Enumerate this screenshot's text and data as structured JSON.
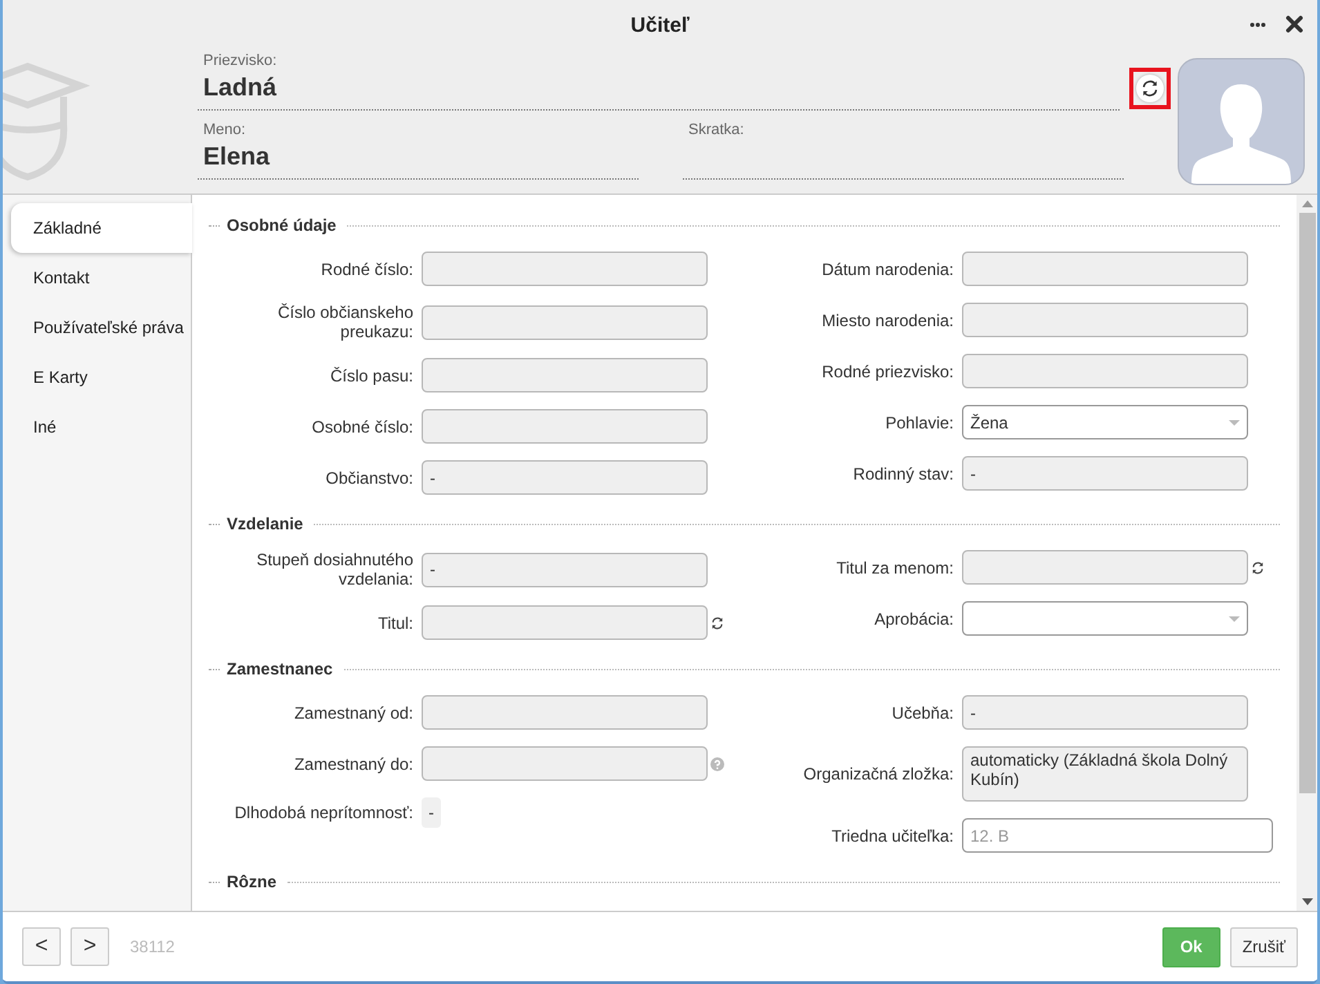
{
  "window": {
    "title": "Učiteľ"
  },
  "header": {
    "surname": {
      "label": "Priezvisko:",
      "value": "Ladná"
    },
    "first_name": {
      "label": "Meno:",
      "value": "Elena"
    },
    "abbreviation": {
      "label": "Skratka:"
    },
    "refresh_highlighted": true
  },
  "tabs": [
    {
      "label": "Základné",
      "selected": true
    },
    {
      "label": "Kontakt",
      "selected": false
    },
    {
      "label": "Používateľské práva",
      "selected": false
    },
    {
      "label": "E Karty",
      "selected": false
    },
    {
      "label": "Iné",
      "selected": false
    }
  ],
  "sections": [
    {
      "title": "Osobné údaje",
      "columns": [
        [
          {
            "kind": "text",
            "label": "Rodné číslo:",
            "editable": false
          },
          {
            "kind": "text",
            "label": "Číslo občianskeho preukazu:",
            "editable": false
          },
          {
            "kind": "text",
            "label": "Číslo pasu:",
            "editable": false
          },
          {
            "kind": "text",
            "label": "Osobné číslo:",
            "editable": false
          },
          {
            "kind": "text",
            "label": "Občianstvo:",
            "value": "-",
            "editable": false
          }
        ],
        [
          {
            "kind": "text",
            "label": "Dátum narodenia:",
            "editable": false
          },
          {
            "kind": "text",
            "label": "Miesto narodenia:",
            "editable": false
          },
          {
            "kind": "text",
            "label": "Rodné priezvisko:",
            "editable": false
          },
          {
            "kind": "select",
            "label": "Pohlavie:",
            "value": "Žena",
            "editable": true
          },
          {
            "kind": "text",
            "label": "Rodinný stav:",
            "value": "-",
            "editable": false
          }
        ]
      ]
    },
    {
      "title": "Vzdelanie",
      "columns": [
        [
          {
            "kind": "text",
            "label": "Stupeň dosiahnutého vzdelania:",
            "value": "-",
            "editable": false
          },
          {
            "kind": "text",
            "label": "Titul:",
            "editable": false,
            "refresh_button": true
          }
        ],
        [
          {
            "kind": "text",
            "label": "Titul za menom:",
            "editable": false,
            "refresh_button": true
          },
          {
            "kind": "select",
            "label": "Aprobácia:",
            "editable": true
          }
        ]
      ]
    },
    {
      "title": "Zamestnanec",
      "columns": [
        [
          {
            "kind": "text",
            "label": "Zamestnaný od:",
            "editable": false
          },
          {
            "kind": "text",
            "label": "Zamestnaný do:",
            "editable": false,
            "help_icon": true
          },
          {
            "kind": "static",
            "label": "Dlhodobá neprítomnosť:",
            "value": "-"
          }
        ],
        [
          {
            "kind": "text",
            "label": "Učebňa:",
            "value": "-",
            "editable": false
          },
          {
            "kind": "textarea",
            "label": "Organizačná zložka:",
            "value": "automaticky (Základná škola Dolný Kubín)",
            "editable": false
          },
          {
            "kind": "text",
            "label": "Triedna učiteľka:",
            "placeholder": "12. B",
            "editable": true,
            "wide": true
          }
        ]
      ]
    },
    {
      "title": "Rôzne"
    }
  ],
  "footer": {
    "prev": "<",
    "next": ">",
    "record_id": "38112",
    "ok": "Ok",
    "cancel": "Zrušiť"
  }
}
